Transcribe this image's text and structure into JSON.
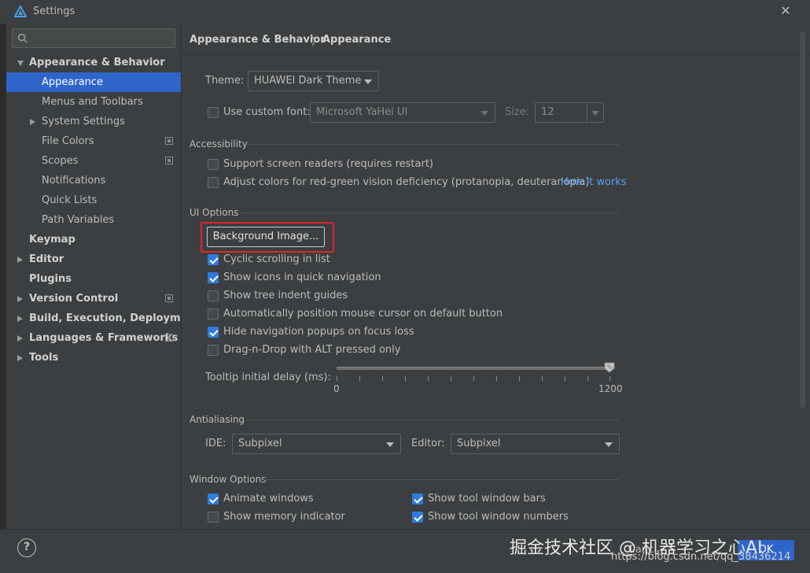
{
  "window": {
    "title": "Settings",
    "close_glyph": "✕"
  },
  "search": {
    "placeholder": "",
    "icon": "search-icon"
  },
  "sidebar": {
    "items": [
      {
        "label": "Appearance & Behavior"
      },
      {
        "label": "Appearance"
      },
      {
        "label": "Menus and Toolbars"
      },
      {
        "label": "System Settings"
      },
      {
        "label": "File Colors"
      },
      {
        "label": "Scopes"
      },
      {
        "label": "Notifications"
      },
      {
        "label": "Quick Lists"
      },
      {
        "label": "Path Variables"
      },
      {
        "label": "Keymap"
      },
      {
        "label": "Editor"
      },
      {
        "label": "Plugins"
      },
      {
        "label": "Version Control"
      },
      {
        "label": "Build, Execution, Deployment"
      },
      {
        "label": "Languages & Frameworks"
      },
      {
        "label": "Tools"
      }
    ]
  },
  "breadcrumb": {
    "parent": "Appearance & Behavior",
    "separator": "〉",
    "current": "Appearance"
  },
  "theme": {
    "label": "Theme:",
    "value": "HUAWEI Dark Theme"
  },
  "font": {
    "checkbox_label": "Use custom font:",
    "checked": false,
    "value": "Microsoft YaHei UI",
    "size_label": "Size:",
    "size_value": "12"
  },
  "accessibility": {
    "title": "Accessibility",
    "screen_readers": {
      "label": "Support screen readers (requires restart)",
      "checked": false
    },
    "red_green": {
      "label": "Adjust colors for red-green vision deficiency (protanopia, deuteranopia)",
      "checked": false
    },
    "how_it_works": "How it works"
  },
  "ui_options": {
    "title": "UI Options",
    "bg_button": "Background Image...",
    "options": [
      {
        "label": "Cyclic scrolling in list",
        "checked": true
      },
      {
        "label": "Show icons in quick navigation",
        "checked": true
      },
      {
        "label": "Show tree indent guides",
        "checked": false
      },
      {
        "label": "Automatically position mouse cursor on default button",
        "checked": false
      },
      {
        "label": "Hide navigation popups on focus loss",
        "checked": true
      },
      {
        "label": "Drag-n-Drop with ALT pressed only",
        "checked": false
      }
    ],
    "tooltip_label": "Tooltip initial delay (ms):",
    "tooltip_min": "0",
    "tooltip_max": "1200",
    "tooltip_value": 1200
  },
  "antialiasing": {
    "title": "Antialiasing",
    "ide_label": "IDE:",
    "ide_value": "Subpixel",
    "editor_label": "Editor:",
    "editor_value": "Subpixel"
  },
  "window_options": {
    "title": "Window Options",
    "animate": {
      "label": "Animate windows",
      "checked": true
    },
    "memory": {
      "label": "Show memory indicator",
      "checked": false
    },
    "tool_bars": {
      "label": "Show tool window bars",
      "checked": true
    },
    "tool_numbers": {
      "label": "Show tool window numbers",
      "checked": true
    }
  },
  "footer": {
    "help": "?",
    "cancel": "Canc",
    "ok": "OK"
  },
  "watermark": {
    "cn": "掘金技术社区 @ 机器学习之心AI",
    "url": "https://blog.csdn.net/qq_38436214"
  },
  "colors": {
    "accent": "#2f65ca",
    "highlight": "#e0262a",
    "link": "#589df6"
  }
}
